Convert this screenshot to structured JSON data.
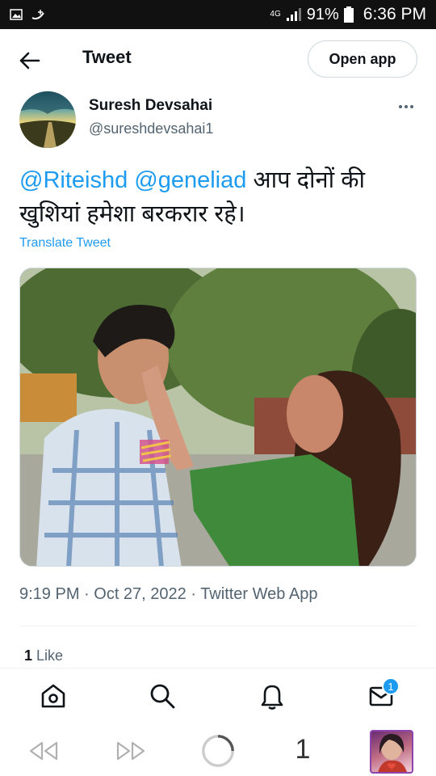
{
  "status_bar": {
    "network": "4G",
    "battery": "91%",
    "time": "6:36 PM"
  },
  "header": {
    "title": "Tweet",
    "open_app_label": "Open app"
  },
  "author": {
    "name": "Suresh Devsahai",
    "handle": "@sureshdevsahai1"
  },
  "tweet": {
    "mention1": "@Riteishd",
    "mention2": "@geneliad",
    "text": " आप दोनों की खुशियां हमेशा बरकरार रहे।",
    "translate_label": "Translate Tweet"
  },
  "meta": {
    "timestamp": "9:19 PM · Oct 27, 2022 · Twitter Web App"
  },
  "stats": {
    "likes_count": "1",
    "likes_label": "Like"
  },
  "bottom_nav": {
    "messages_badge": "1"
  },
  "browser": {
    "tab_count": "1"
  },
  "icons": [
    "back-arrow-icon",
    "more-icon",
    "home-icon",
    "search-icon",
    "notifications-icon",
    "messages-icon",
    "rewind-icon",
    "forward-icon",
    "reload-icon"
  ],
  "colors": {
    "accent": "#1d9bf0",
    "text": "#0f1419",
    "muted": "#536471",
    "status_bar": "#111111"
  }
}
